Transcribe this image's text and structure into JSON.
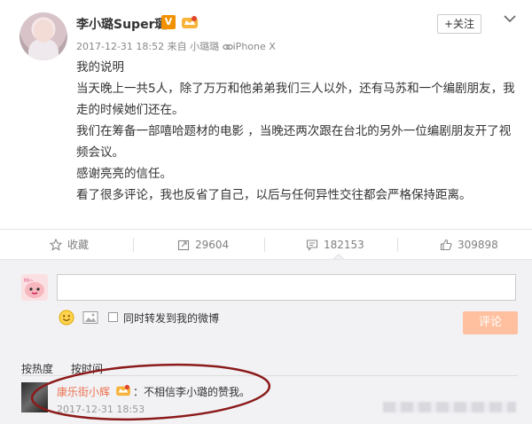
{
  "post": {
    "user_name": "李小璐Super璐",
    "verified_badge": "V",
    "timestamp": "2017-12-31 18:52",
    "source": "来自 小璐璐",
    "device": "iPhone X",
    "follow_label": "+关注",
    "paragraphs": [
      "我的说明",
      "",
      "当天晚上一共5人，除了万万和他弟弟我们三人以外，还有马苏和一个编剧朋友，我走的时候她们还在。",
      "我们在筹备一部嘻哈题材的电影 ，当晚还两次跟在台北的另外一位编剧朋友开了视频会议。",
      "感谢亮亮的信任。",
      "看了很多评论，我也反省了自己，以后与任何异性交往都会严格保持距离。"
    ]
  },
  "actions": {
    "favorite_label": "收藏",
    "repost_count": "29604",
    "comment_count": "182153",
    "like_count": "309898"
  },
  "compose": {
    "forward_label": "同时转发到我的微博",
    "submit_label": "评论"
  },
  "sort": {
    "by_hot": "按热度",
    "by_time": "按时间"
  },
  "comment": {
    "user": "康乐街小辉",
    "text": "：不相信李小璐的赞我。",
    "time": "2017-12-31 18:53"
  },
  "colors": {
    "accent_orange": "#eb7350",
    "verified_orange": "#f29100",
    "submit_disabled": "#ffc09f",
    "annotation_red": "#8b1a1a"
  }
}
